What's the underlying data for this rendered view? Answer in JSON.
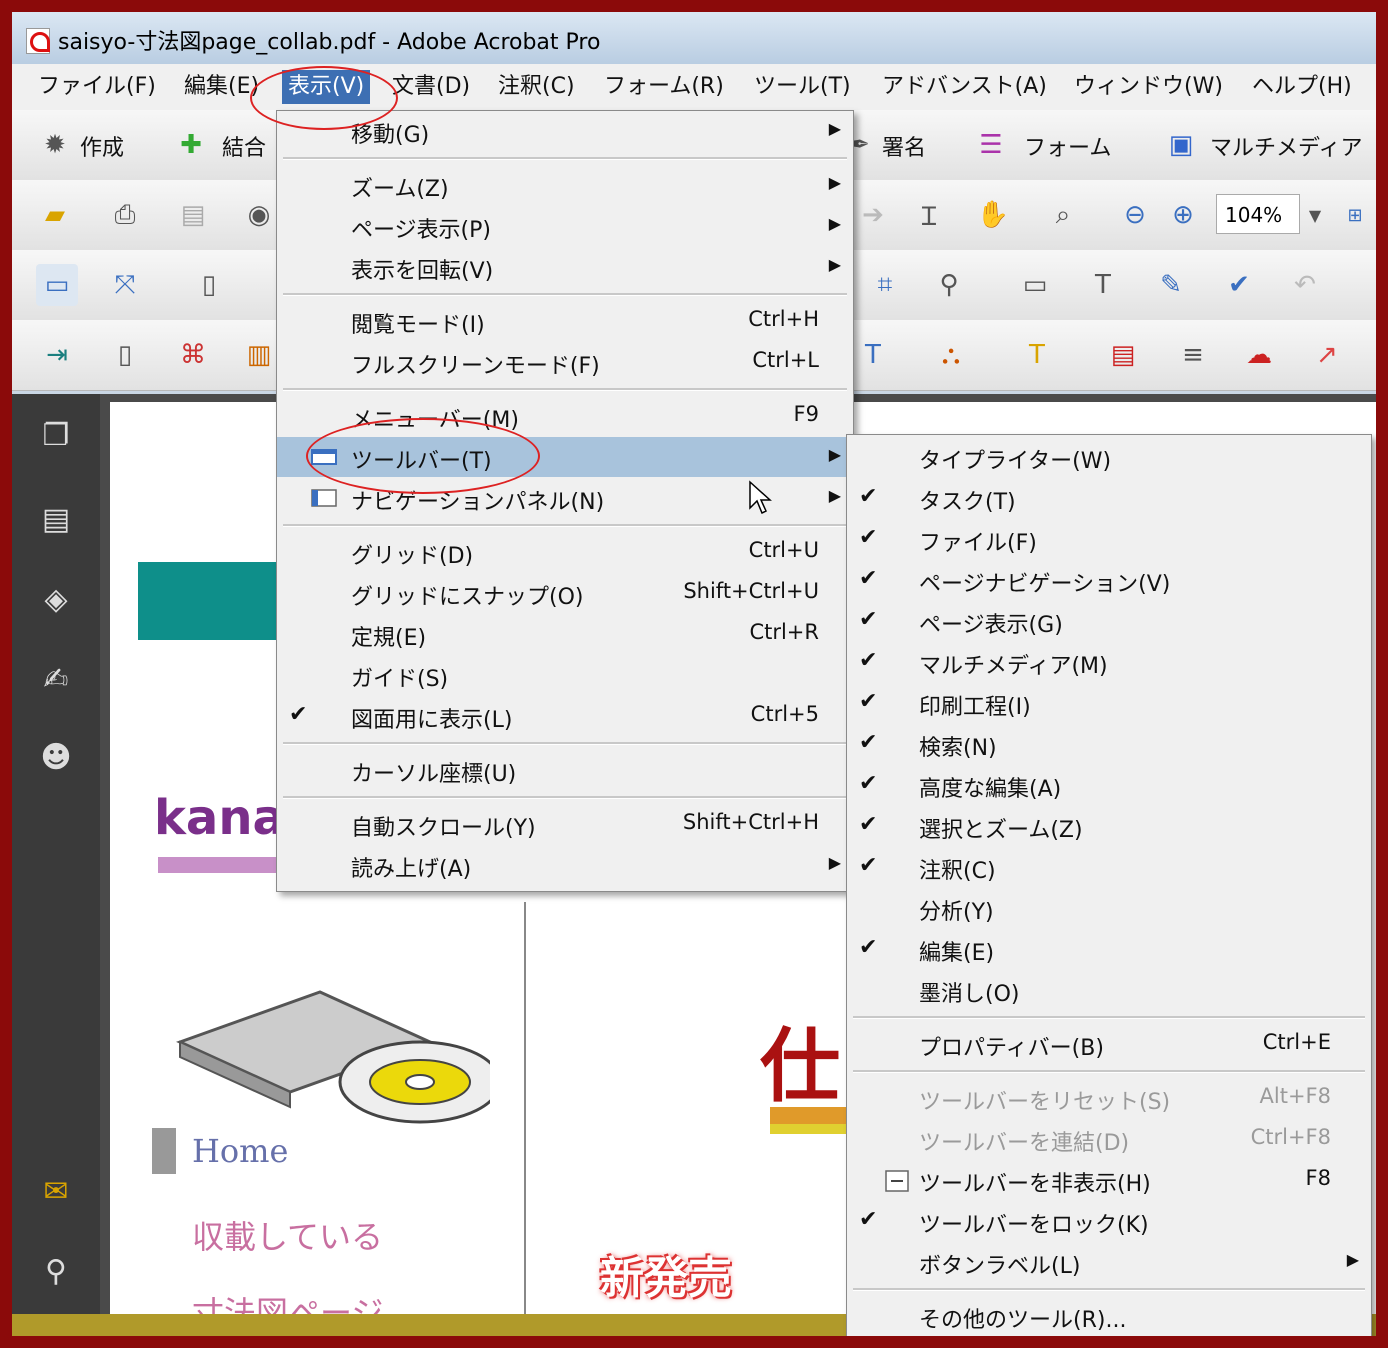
{
  "window": {
    "title": "saisyo-寸法図page_collab.pdf - Adobe Acrobat Pro"
  },
  "menubar": {
    "items": [
      "ファイル(F)",
      "編集(E)",
      "表示(V)",
      "文書(D)",
      "注釈(C)",
      "フォーム(R)",
      "ツール(T)",
      "アドバンスト(A)",
      "ウィンドウ(W)",
      "ヘルプ(H)"
    ],
    "active": "表示(V)"
  },
  "toolbar1": {
    "create": "作成",
    "combine": "結合",
    "sign": "署名",
    "forms": "フォーム",
    "multimedia": "マルチメディア"
  },
  "toolbar2": {
    "zoom": "104%"
  },
  "view_menu": {
    "items": [
      {
        "label": "移動(G)",
        "shortcut": "",
        "submenu": true
      },
      {
        "label": "ズーム(Z)",
        "shortcut": "",
        "submenu": true
      },
      {
        "label": "ページ表示(P)",
        "shortcut": "",
        "submenu": true
      },
      {
        "label": "表示を回転(V)",
        "shortcut": "",
        "submenu": true
      },
      {
        "label": "閲覧モード(I)",
        "shortcut": "Ctrl+H"
      },
      {
        "label": "フルスクリーンモード(F)",
        "shortcut": "Ctrl+L"
      },
      {
        "label": "メニューバー(M)",
        "shortcut": "F9"
      },
      {
        "label": "ツールバー(T)",
        "shortcut": "",
        "submenu": true
      },
      {
        "label": "ナビゲーションパネル(N)",
        "shortcut": "",
        "submenu": true
      },
      {
        "label": "グリッド(D)",
        "shortcut": "Ctrl+U"
      },
      {
        "label": "グリッドにスナップ(O)",
        "shortcut": "Shift+Ctrl+U"
      },
      {
        "label": "定規(E)",
        "shortcut": "Ctrl+R"
      },
      {
        "label": "ガイド(S)",
        "shortcut": ""
      },
      {
        "label": "図面用に表示(L)",
        "shortcut": "Ctrl+5",
        "checked": true
      },
      {
        "label": "カーソル座標(U)",
        "shortcut": ""
      },
      {
        "label": "自動スクロール(Y)",
        "shortcut": "Shift+Ctrl+H"
      },
      {
        "label": "読み上げ(A)",
        "shortcut": "",
        "submenu": true
      }
    ]
  },
  "toolbar_submenu": {
    "items": [
      {
        "label": "タイプライター(W)",
        "checked": false
      },
      {
        "label": "タスク(T)",
        "checked": true
      },
      {
        "label": "ファイル(F)",
        "checked": true
      },
      {
        "label": "ページナビゲーション(V)",
        "checked": true
      },
      {
        "label": "ページ表示(G)",
        "checked": true
      },
      {
        "label": "マルチメディア(M)",
        "checked": true
      },
      {
        "label": "印刷工程(I)",
        "checked": true
      },
      {
        "label": "検索(N)",
        "checked": true
      },
      {
        "label": "高度な編集(A)",
        "checked": true
      },
      {
        "label": "選択とズーム(Z)",
        "checked": true
      },
      {
        "label": "注釈(C)",
        "checked": true
      },
      {
        "label": "分析(Y)",
        "checked": false
      },
      {
        "label": "編集(E)",
        "checked": true
      },
      {
        "label": "墨消し(O)",
        "checked": false
      },
      {
        "label": "プロパティバー(B)",
        "shortcut": "Ctrl+E"
      },
      {
        "label": "ツールバーをリセット(S)",
        "shortcut": "Alt+F8",
        "disabled": true
      },
      {
        "label": "ツールバーを連結(D)",
        "shortcut": "Ctrl+F8",
        "disabled": true
      },
      {
        "label": "ツールバーを非表示(H)",
        "shortcut": "F8"
      },
      {
        "label": "ツールバーをロック(K)",
        "checked": true
      },
      {
        "label": "ボタンラベル(L)",
        "submenu": true
      },
      {
        "label": "その他のツール(R)..."
      }
    ]
  },
  "document": {
    "brand": "kanar",
    "nav_home": "Home",
    "nav_item1": "収載している",
    "nav_item2": "寸法図ページ",
    "headline": "仕",
    "badge": "新発売"
  },
  "colors": {
    "accent": "#3d6fb3",
    "highlight": "#a8c3dc",
    "teal": "#0e8f8a",
    "frame": "#8b0a0a"
  }
}
